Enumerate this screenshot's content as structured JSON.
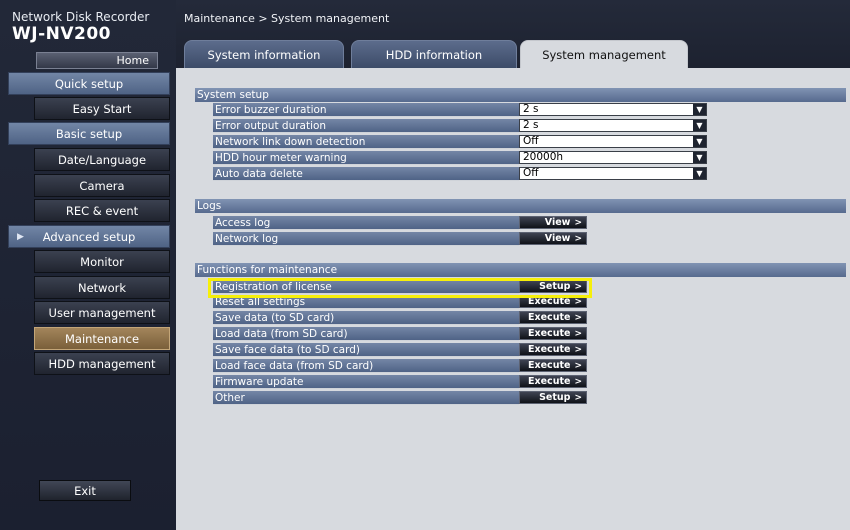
{
  "app": {
    "brand_line1": "Network Disk Recorder",
    "brand_line2": "WJ-NV200",
    "home_label": "Home",
    "exit_label": "Exit"
  },
  "sidebar": {
    "items": [
      {
        "label": "Quick setup",
        "kind": "group"
      },
      {
        "label": "Easy Start",
        "kind": "sub"
      },
      {
        "label": "Basic setup",
        "kind": "group"
      },
      {
        "label": "Date/Language",
        "kind": "sub"
      },
      {
        "label": "Camera",
        "kind": "sub"
      },
      {
        "label": "REC & event",
        "kind": "sub"
      },
      {
        "label": "Advanced setup",
        "kind": "group"
      },
      {
        "label": "Monitor",
        "kind": "sub"
      },
      {
        "label": "Network",
        "kind": "sub"
      },
      {
        "label": "User management",
        "kind": "sub"
      },
      {
        "label": "Maintenance",
        "kind": "sub",
        "selected": true
      },
      {
        "label": "HDD management",
        "kind": "sub"
      }
    ]
  },
  "header": {
    "breadcrumb": "Maintenance  >  System management",
    "tabs": [
      {
        "label": "System information",
        "active": false
      },
      {
        "label": "HDD information",
        "active": false
      },
      {
        "label": "System management",
        "active": true
      }
    ]
  },
  "main": {
    "system_setup": {
      "title": "System setup",
      "rows": [
        {
          "label": "Error buzzer duration",
          "value": "2 s"
        },
        {
          "label": "Error output duration",
          "value": "2 s"
        },
        {
          "label": "Network link down detection",
          "value": "Off"
        },
        {
          "label": "HDD hour meter warning",
          "value": "20000h"
        },
        {
          "label": "Auto data delete",
          "value": "Off"
        }
      ]
    },
    "logs": {
      "title": "Logs",
      "rows": [
        {
          "label": "Access log",
          "button": "View"
        },
        {
          "label": "Network log",
          "button": "View"
        }
      ]
    },
    "maintenance": {
      "title": "Functions for maintenance",
      "rows": [
        {
          "label": "Registration of license",
          "button": "Setup",
          "highlighted": true
        },
        {
          "label": "Reset all settings",
          "button": "Execute"
        },
        {
          "label": "Save data (to SD card)",
          "button": "Execute"
        },
        {
          "label": "Load data (from SD card)",
          "button": "Execute"
        },
        {
          "label": "Save face data (to SD card)",
          "button": "Execute"
        },
        {
          "label": "Load face data (from SD card)",
          "button": "Execute"
        },
        {
          "label": "Firmware update",
          "button": "Execute"
        },
        {
          "label": "Other",
          "button": "Setup"
        }
      ]
    },
    "colors": {
      "highlight": "#f6ef0a",
      "selected_nav": "#a3855b"
    }
  }
}
